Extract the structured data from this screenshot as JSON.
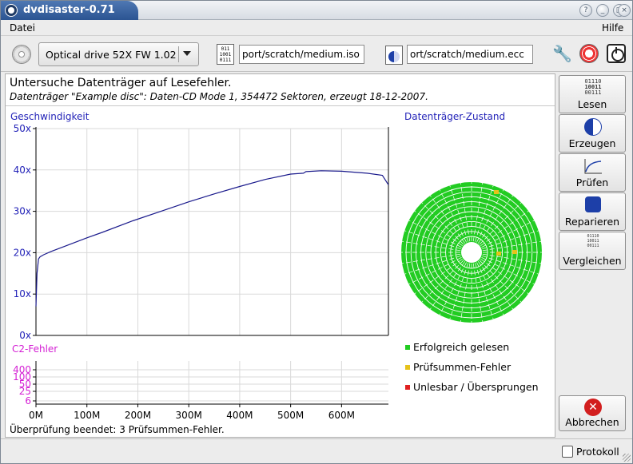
{
  "window": {
    "title": "dvdisaster-0.71"
  },
  "title_buttons": {
    "help": "?",
    "minimize": "_",
    "maximize": "□",
    "close": "×"
  },
  "menubar": {
    "file": "Datei",
    "help": "Hilfe"
  },
  "toolbar": {
    "drive": "Optical drive 52X FW 1.02",
    "image_file": "port/scratch/medium.iso",
    "ecc_file": "ort/scratch/medium.ecc",
    "icons": [
      "cd-icon",
      "image-file-icon",
      "ecc-file-icon",
      "wrench-icon",
      "help-lifebuoy-icon",
      "quit-icon"
    ]
  },
  "main": {
    "heading": "Untersuche Datenträger auf Lesefehler.",
    "subheading": "Datenträger \"Example disc\": Daten-CD Mode 1, 354472 Sektoren, erzeugt 18-12-2007.",
    "speed_title": "Geschwindigkeit",
    "c2_title": "C2-Fehler",
    "disc_title": "Datenträger-Zustand",
    "status": "Überprüfung beendet: 3 Prüfsummen-Fehler."
  },
  "legend": [
    {
      "label": "Erfolgreich gelesen",
      "color": "#22cc22"
    },
    {
      "label": "Prüfsummen-Fehler",
      "color": "#e6c21a"
    },
    {
      "label": "Unlesbar / Übersprungen",
      "color": "#e02020"
    }
  ],
  "side_buttons": {
    "read": "Lesen",
    "read_bits": [
      "01110",
      "10011",
      "00111"
    ],
    "create": "Erzeugen",
    "verify": "Prüfen",
    "repair": "Reparieren",
    "compare": "Vergleichen",
    "compare_bits": [
      "01110",
      "10011",
      "00111"
    ],
    "abort": "Abbrechen",
    "abort_icon": "✕"
  },
  "statusbar": {
    "log": "Protokoll"
  },
  "colors": {
    "axis_blue": "#2323b8",
    "curve": "#1a1a8c",
    "c2_magenta": "#d41fd4",
    "disc_green": "#22cc22",
    "titlebar": "#2b5492"
  },
  "chart_data": [
    {
      "type": "line",
      "title": "Geschwindigkeit",
      "ylabel": "",
      "y_ticks": [
        "0x",
        "10x",
        "20x",
        "30x",
        "40x",
        "50x"
      ],
      "ylim": [
        0,
        50
      ],
      "x_ticks": [
        "0M",
        "100M",
        "200M",
        "300M",
        "400M",
        "500M",
        "600M"
      ],
      "xlim": [
        0,
        692
      ],
      "grid": true,
      "series": [
        {
          "x": [
            0,
            2,
            5,
            8,
            15,
            30,
            60,
            100,
            130,
            190,
            250,
            300,
            350,
            400,
            450,
            500,
            525,
            530,
            560,
            600,
            650,
            680,
            692
          ],
          "y": [
            7,
            15,
            18.5,
            19,
            19.5,
            20.3,
            21.7,
            23.6,
            24.9,
            27.7,
            30.2,
            32.3,
            34.2,
            36,
            37.7,
            39.0,
            39.2,
            39.6,
            39.8,
            39.7,
            39.2,
            38.7,
            36.4
          ]
        }
      ]
    },
    {
      "type": "line",
      "title": "C2-Fehler",
      "y_ticks": [
        "400",
        "100",
        "50",
        "25",
        "6"
      ],
      "x_ticks": [
        "0M",
        "100M",
        "200M",
        "300M",
        "400M",
        "500M",
        "600M"
      ],
      "xlim": [
        0,
        692
      ],
      "grid": true,
      "series": []
    }
  ]
}
